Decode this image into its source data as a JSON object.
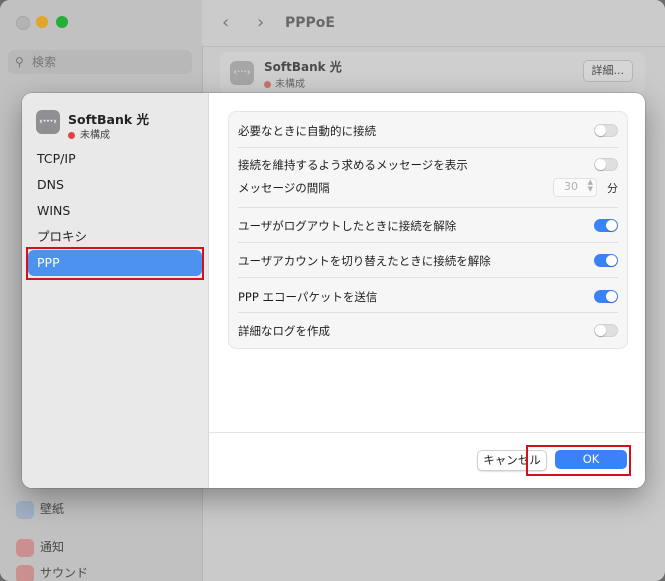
{
  "background": {
    "search_placeholder": "検索",
    "sidebar_items": [
      {
        "label": "壁紙",
        "color": "#b8c9e0"
      },
      {
        "label": "通知",
        "color": "#e9a3a3"
      },
      {
        "label": "サウンド",
        "color": "#e9a3a3"
      }
    ],
    "header_title": "PPPoE",
    "service_name": "SoftBank 光",
    "service_status": "未構成",
    "detail_button": "詳細..."
  },
  "sheet": {
    "service": {
      "icon": "network-dots-icon",
      "icon_glyph": "‹···›",
      "name": "SoftBank 光",
      "status": "未構成",
      "status_color": "#e0443e"
    },
    "nav": [
      {
        "label": "TCP/IP",
        "selected": false
      },
      {
        "label": "DNS",
        "selected": false
      },
      {
        "label": "WINS",
        "selected": false
      },
      {
        "label": "プロキシ",
        "selected": false
      },
      {
        "label": "PPP",
        "selected": true
      }
    ],
    "options": [
      {
        "label": "必要なときに自動的に接続",
        "on": false
      },
      {
        "label": "接続を維持するよう求めるメッセージを表示",
        "on": false
      },
      {
        "label": "ユーザがログアウトしたときに接続を解除",
        "on": true
      },
      {
        "label": "ユーザアカウントを切り替えたときに接続を解除",
        "on": true
      },
      {
        "label": "PPP エコーパケットを送信",
        "on": true
      },
      {
        "label": "詳細なログを作成",
        "on": false
      }
    ],
    "message_interval": {
      "label": "メッセージの間隔",
      "value": "30",
      "unit": "分"
    },
    "cancel_label": "キャンセル",
    "ok_label": "OK",
    "accent_color": "#3a82f7",
    "highlight_color": "#d4101c"
  }
}
